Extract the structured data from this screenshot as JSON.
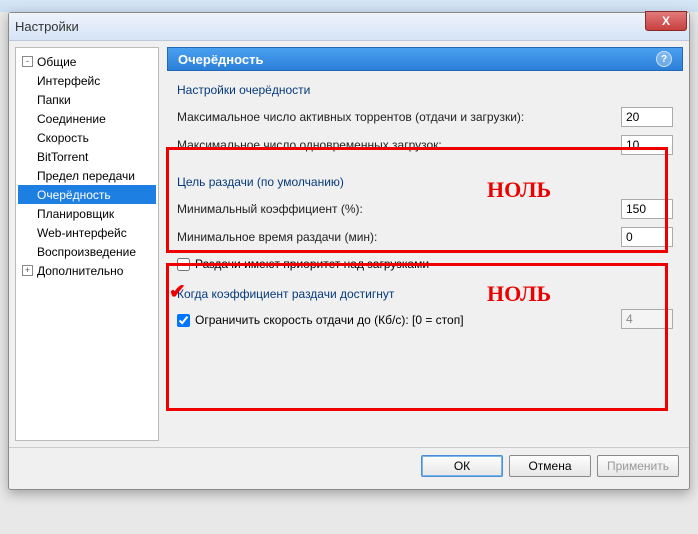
{
  "window": {
    "title": "Настройки",
    "close_label": "X"
  },
  "sidebar": {
    "items": [
      {
        "label": "Общие",
        "toggle": "-"
      },
      {
        "label": "Интерфейс"
      },
      {
        "label": "Папки"
      },
      {
        "label": "Соединение"
      },
      {
        "label": "Скорость"
      },
      {
        "label": "BitTorrent"
      },
      {
        "label": "Предел передачи"
      },
      {
        "label": "Очерёдность",
        "selected": true
      },
      {
        "label": "Планировщик"
      },
      {
        "label": "Web-интерфейс"
      },
      {
        "label": "Воспроизведение"
      },
      {
        "label": "Дополнительно",
        "toggle": "+"
      }
    ]
  },
  "main": {
    "header": "Очерёдность",
    "help": "?",
    "group1": {
      "title": "Настройки очерёдности",
      "max_active_label": "Максимальное число активных торрентов (отдачи и загрузки):",
      "max_active_value": "20",
      "max_dl_label": "Максимальное число одновременных загрузок:",
      "max_dl_value": "10"
    },
    "group2": {
      "title": "Цель раздачи (по умолчанию)",
      "min_ratio_label": "Минимальный коэффициент (%):",
      "min_ratio_value": "150",
      "min_time_label": "Минимальное время раздачи (мин):",
      "min_time_value": "0",
      "priority_label": "Раздачи имеют приоритет над загрузками"
    },
    "group3": {
      "title": "Когда коэффициент раздачи достигнут",
      "limit_label": "Ограничить скорость отдачи до (Кб/с): [0 = стоп]",
      "limit_value": "4"
    },
    "annotations": {
      "a1": "НОЛЬ",
      "a2": "НОЛЬ"
    }
  },
  "footer": {
    "ok": "ОК",
    "cancel": "Отмена",
    "apply": "Применить"
  }
}
